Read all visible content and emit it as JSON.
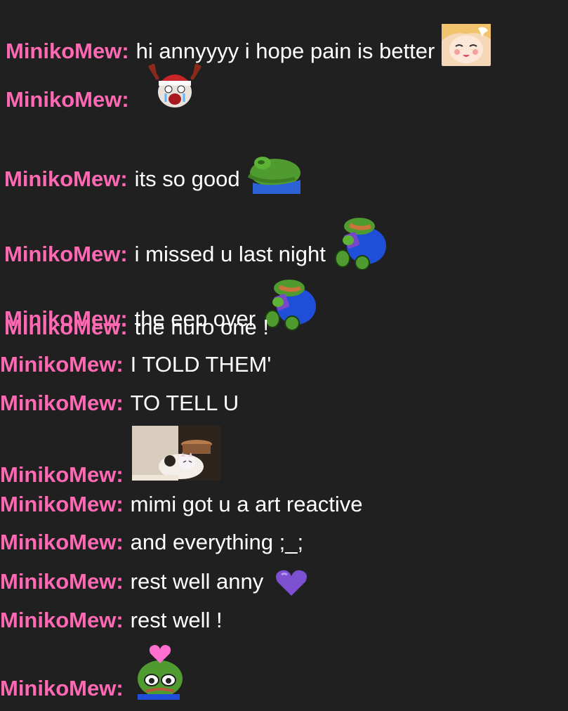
{
  "theme": {
    "background": "#202020",
    "username_color": "#ff69b4",
    "text_color": "#ffffff"
  },
  "messages": [
    {
      "user": "MinikoMew:",
      "text": "hi annyyyy i hope pain is better",
      "emote": "anime-girl-emote"
    },
    {
      "user": "MinikoMew:",
      "text": "",
      "emote": "crying-reindeer-emote"
    },
    {
      "user": "MinikoMew:",
      "text": "its so good",
      "emote": "pepe-blanket-emote"
    },
    {
      "user": "MinikoMew:",
      "text": "i missed u last night",
      "emote": "pepe-hug-emote"
    },
    {
      "user": "MinikoMew:",
      "text": "the eep over",
      "emote": "pepe-hug-emote"
    },
    {
      "user": "MinikoMew:",
      "text": "the nuro one !"
    },
    {
      "user": "MinikoMew:",
      "text": "I TOLD THEM'"
    },
    {
      "user": "MinikoMew:",
      "text": "TO TELL U"
    },
    {
      "user": "MinikoMew:",
      "text": "",
      "emote": "cat-photo-emote"
    },
    {
      "user": "MinikoMew:",
      "text": "mimi got u a art reactive"
    },
    {
      "user": "MinikoMew:",
      "text": "and everything ;_;"
    },
    {
      "user": "MinikoMew:",
      "text": "rest well anny",
      "emote": "purple-heart-emote"
    },
    {
      "user": "MinikoMew:",
      "text": "rest well !"
    },
    {
      "user": "MinikoMew:",
      "text": "",
      "emote": "pepe-heart-emote"
    }
  ]
}
